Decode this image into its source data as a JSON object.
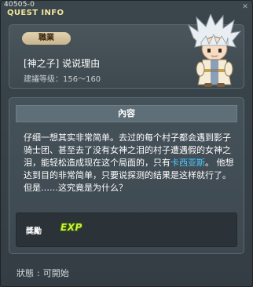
{
  "window": {
    "id": "40505-0",
    "title": "QUEST INFO",
    "close_glyph": "✕"
  },
  "info": {
    "job_badge": "職業",
    "quest_name": "[神之子] 说说理由",
    "level_label": "建議等级",
    "level_range": "156～160"
  },
  "content": {
    "header": "內容",
    "text_before": "仔细一想其实非常简单。去过的每个村子都会遇到影子骑士团、甚至去了没有女神之泪的村子遭遇假的女神之泪，能轻松造成现在这个局面的，只有",
    "npc": "卡西亚斯",
    "text_after": "。 他想达到目的非常简单，只要说探测的结果是这样就行了。但是……这究竟是为什么？"
  },
  "reward": {
    "label": "獎勵",
    "exp_icon": "EXP"
  },
  "status": {
    "label": "狀態",
    "value": "可開始"
  },
  "colors": {
    "title": "#f2e49a",
    "npc_link": "#4ec8ff",
    "exp": "#c8f040"
  }
}
